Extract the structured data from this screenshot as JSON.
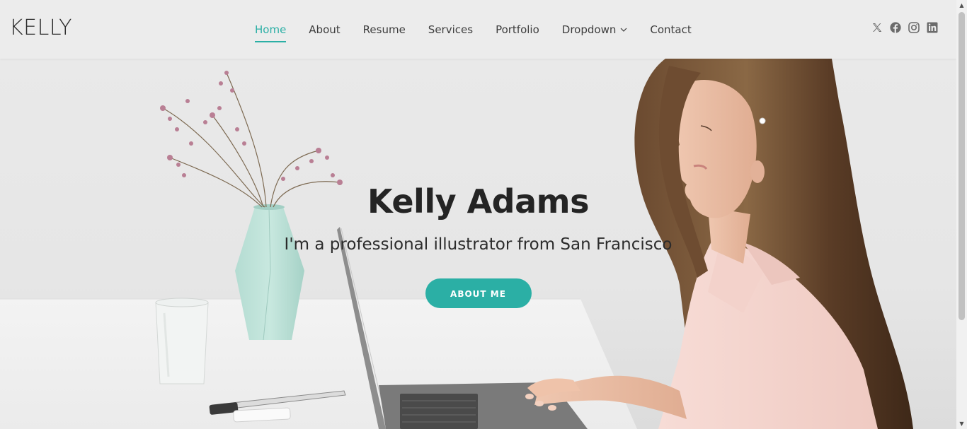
{
  "header": {
    "logo": "KELLY",
    "nav": [
      {
        "label": "Home",
        "active": true
      },
      {
        "label": "About"
      },
      {
        "label": "Resume"
      },
      {
        "label": "Services"
      },
      {
        "label": "Portfolio"
      },
      {
        "label": "Dropdown",
        "has_submenu": true
      },
      {
        "label": "Contact"
      }
    ],
    "socials": [
      "x-icon",
      "facebook-icon",
      "instagram-icon",
      "linkedin-icon"
    ]
  },
  "hero": {
    "title": "Kelly Adams",
    "subtitle": "I'm a professional illustrator from San Francisco",
    "button_label": "ABOUT ME"
  },
  "colors": {
    "accent": "#2bafa5",
    "text_dark": "#242424",
    "header_bg": "#ececec"
  }
}
